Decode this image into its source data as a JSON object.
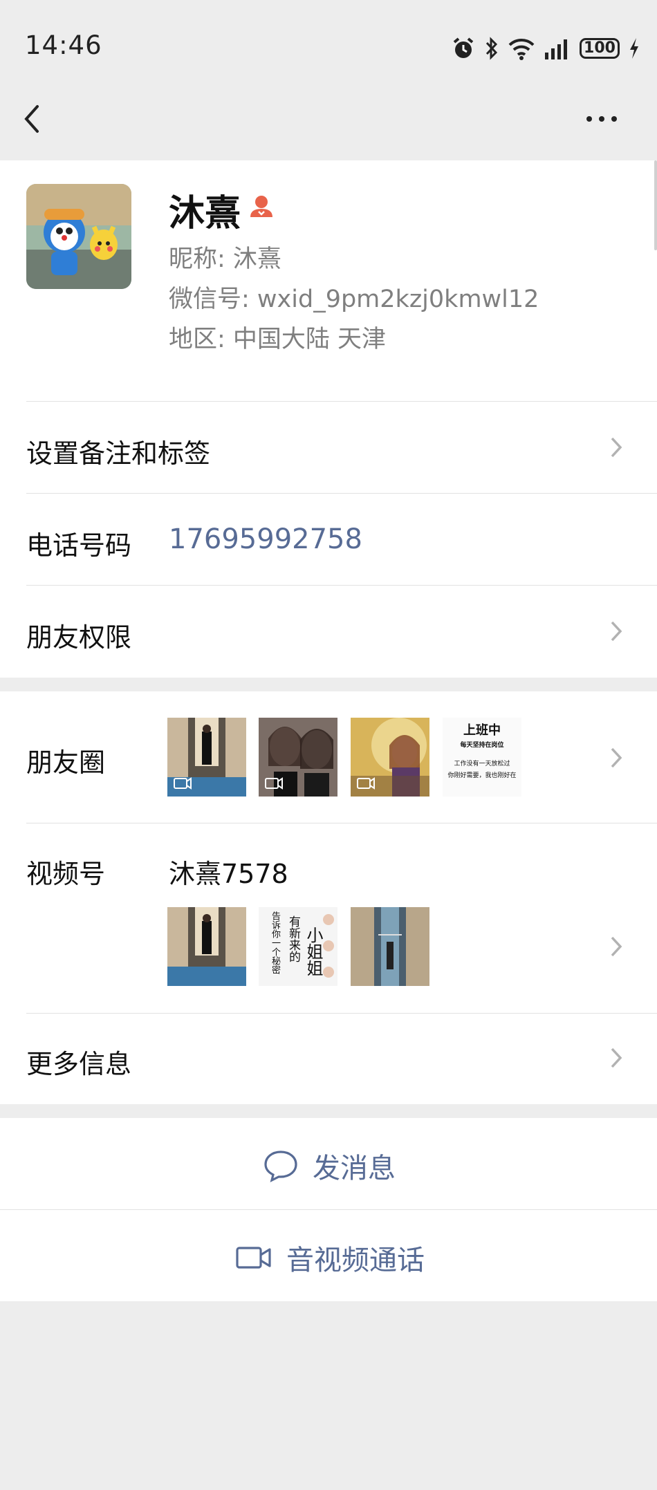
{
  "status_bar": {
    "time": "14:46",
    "battery": "100",
    "icons": [
      "alarm-icon",
      "bluetooth-icon",
      "wifi-icon",
      "signal-icon",
      "battery-icon",
      "charging-icon"
    ]
  },
  "header": {
    "back_icon": "chevron-left-icon",
    "more_icon": "more-dots-icon"
  },
  "profile": {
    "name": "沐熹",
    "badge_icon": "person-badge-icon",
    "nickname": "昵称:  沐熹",
    "wechat_id": "微信号:  wxid_9pm2kzj0kmwl12",
    "region": "地区:  中国大陆  天津"
  },
  "rows": {
    "remark_label": "设置备注和标签",
    "phone_label": "电话号码",
    "phone_value": "17695992758",
    "permissions_label": "朋友权限",
    "moments_label": "朋友圈",
    "channels_label": "视频号",
    "channels_name": "沐熹7578",
    "more_info_label": "更多信息"
  },
  "moments_thumbs": {
    "poster_title": "上班中",
    "poster_line1": "每天坚持在岗位",
    "poster_line2": "工作没有一天放松过",
    "poster_line3": "你刚好需要，我也刚好在"
  },
  "channels_thumbs": {
    "poster_text_small": "告诉你一个秘密",
    "poster_text_mid": "有新来的",
    "poster_text_big": "小姐姐"
  },
  "actions": {
    "send_message": "发消息",
    "av_call": "音视频通话"
  },
  "colors": {
    "link": "#576b95",
    "background": "#ededed",
    "badge": "#e8634a"
  }
}
